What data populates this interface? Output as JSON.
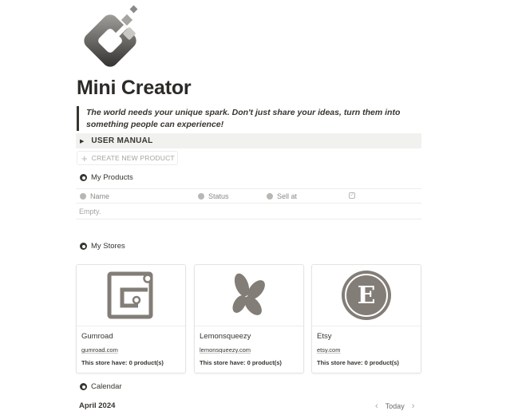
{
  "page": {
    "title": "Mini Creator",
    "quote": "The world needs your unique spark. Don't just share your ideas, turn them into something people can experience!",
    "colors": {
      "text": "#37352f",
      "logo_light": "#8c8a86",
      "logo_dark": "#3a3936",
      "store_icon": "#837d77"
    }
  },
  "toggle": {
    "label": "USER MANUAL",
    "icon": "triangle-right-icon"
  },
  "create_button": {
    "label": "CREATE NEW PRODUCT",
    "icon": "plus-icon"
  },
  "products": {
    "heading": "My Products",
    "columns": [
      "Name",
      "Status",
      "Sell at"
    ],
    "checkbox_column_icon": "checkbox-icon",
    "empty_text": "Empty."
  },
  "stores": {
    "heading": "My Stores",
    "cards": [
      {
        "name": "Gumroad",
        "url": "gumroad.com",
        "info": "This store have: 0 product(s)",
        "icon": "gumroad-logo-icon"
      },
      {
        "name": "Lemonsqueezy",
        "url": "lemonsqueezy.com",
        "info": "This store have: 0 product(s)",
        "icon": "lemonsqueezy-logo-icon"
      },
      {
        "name": "Etsy",
        "url": "etsy.com",
        "info": "This store have: 0 product(s)",
        "icon": "etsy-logo-icon"
      }
    ]
  },
  "calendar": {
    "heading": "Calendar",
    "month": "April 2024",
    "today_label": "Today",
    "prev_icon": "chevron-left-icon",
    "next_icon": "chevron-right-icon"
  }
}
